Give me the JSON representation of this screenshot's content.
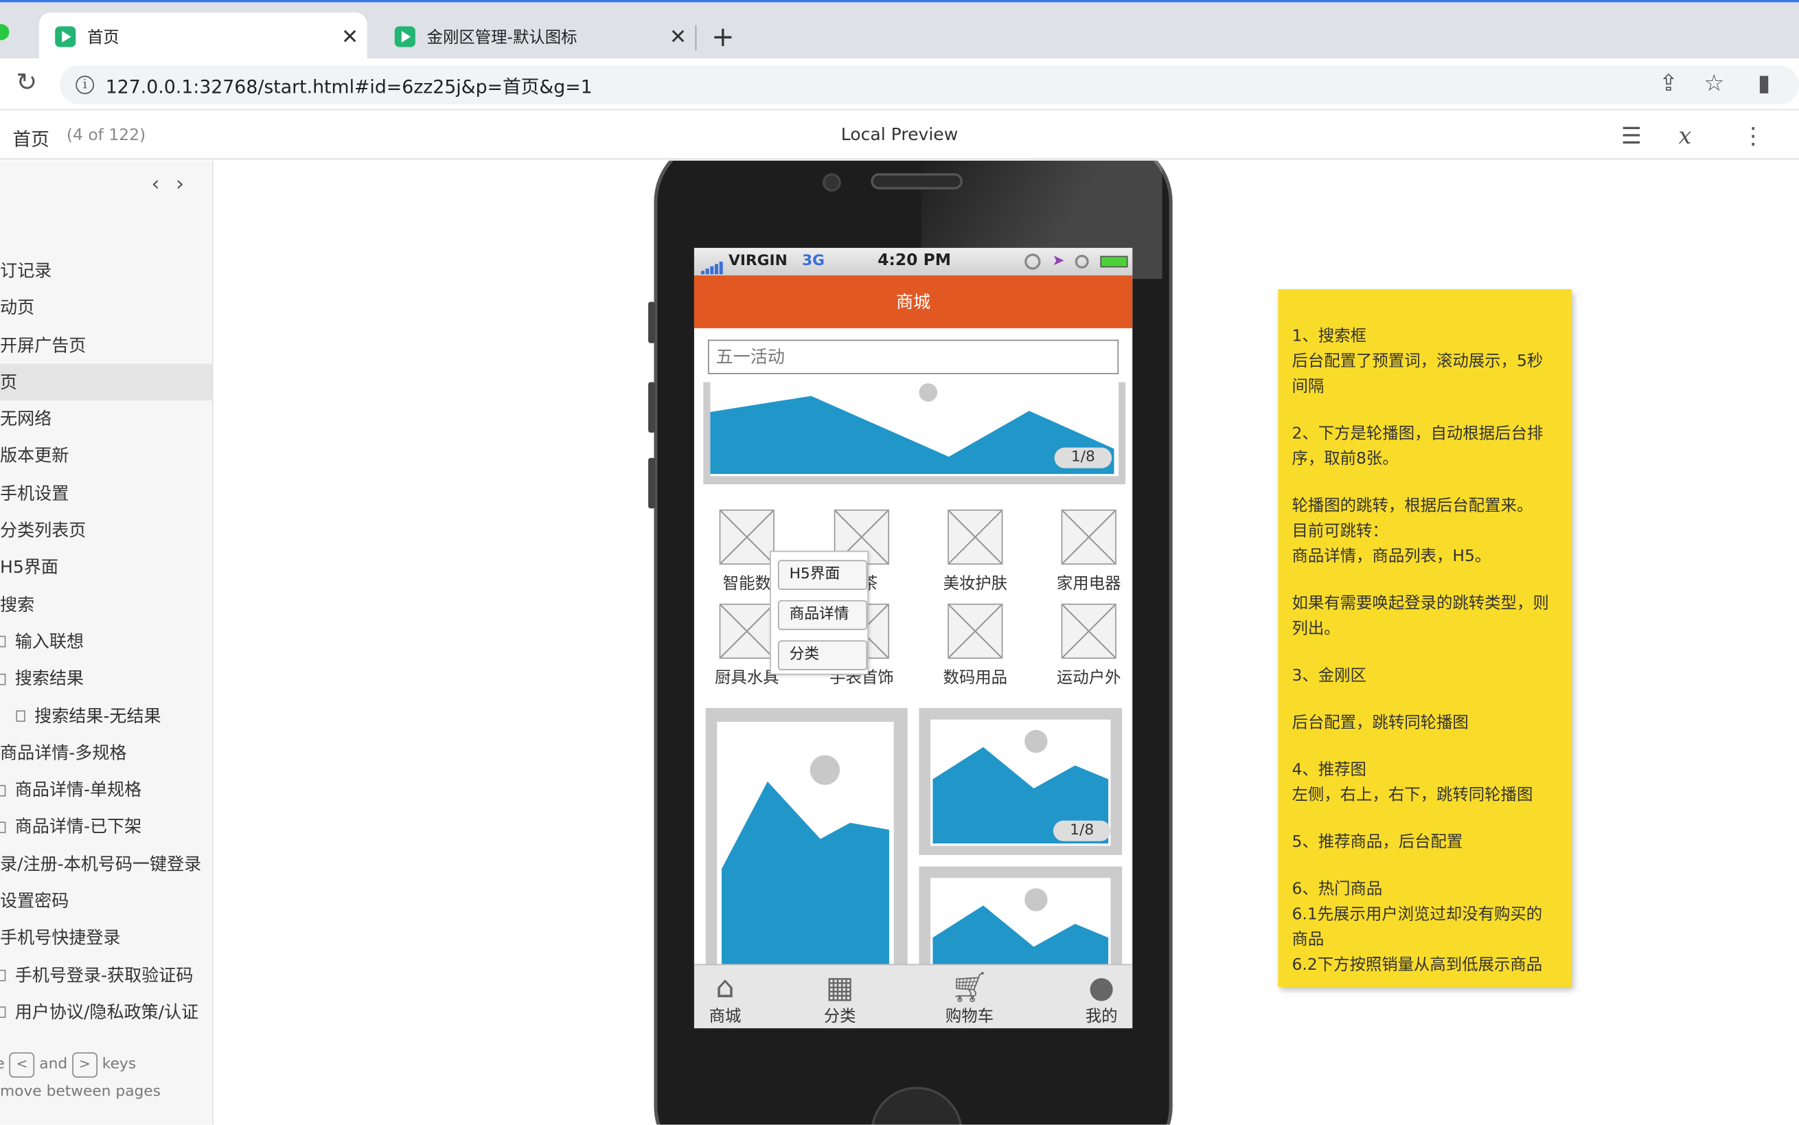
{
  "browser": {
    "tabs": [
      {
        "title": "首页",
        "active": true
      },
      {
        "title": "金刚区管理-默认图标",
        "active": false
      }
    ],
    "new_tab": "+",
    "url": "127.0.0.1:32768/start.html#id=6zz25j&p=首页&g=1"
  },
  "preview": {
    "page_title": "首页",
    "page_count": "(4 of 122)",
    "center_label": "Local Preview"
  },
  "sidebar": {
    "pages": [
      {
        "label": "订记录",
        "icon": false
      },
      {
        "label": "动页",
        "icon": false
      },
      {
        "label": "开屏广告页",
        "icon": false
      },
      {
        "label": "页",
        "icon": false,
        "selected": true
      },
      {
        "label": "无网络",
        "icon": false
      },
      {
        "label": "版本更新",
        "icon": false
      },
      {
        "label": "手机设置",
        "icon": false
      },
      {
        "label": "分类列表页",
        "icon": false
      },
      {
        "label": "H5界面",
        "icon": false
      },
      {
        "label": "搜索",
        "icon": false
      },
      {
        "label": "输入联想",
        "icon": true
      },
      {
        "label": "搜索结果",
        "icon": true
      },
      {
        "label": "搜索结果-无结果",
        "icon": true,
        "indent": true
      },
      {
        "label": "商品详情-多规格",
        "icon": false
      },
      {
        "label": "商品详情-单规格",
        "icon": true
      },
      {
        "label": "商品详情-已下架",
        "icon": true
      },
      {
        "label": "录/注册-本机号码一键登录",
        "icon": false
      },
      {
        "label": "设置密码",
        "icon": false
      },
      {
        "label": "手机号快捷登录",
        "icon": false
      },
      {
        "label": "手机号登录-获取验证码",
        "icon": true
      },
      {
        "label": "用户协议/隐私政策/认证",
        "icon": true
      }
    ],
    "hint": {
      "prefix": "e",
      "key_left": "<",
      "and": "and",
      "key_right": ">",
      "keys": "keys",
      "line2": "move between pages"
    }
  },
  "phone": {
    "status": {
      "carrier": "VIRGIN",
      "network": "3G",
      "time": "4:20 PM"
    },
    "app_title": "商城",
    "search_placeholder": "五一活动",
    "banner_pager": "1/8",
    "categories": [
      "智能数",
      "名茶",
      "美妆护肤",
      "家用电器",
      "厨具水具",
      "手表首饰",
      "数码用品",
      "运动户外"
    ],
    "dropdown": [
      "H5界面",
      "商品详情",
      "分类"
    ],
    "rec_pager": "1/8",
    "tabbar": [
      "商城",
      "分类",
      "购物车",
      "我的"
    ]
  },
  "note": {
    "paragraphs": [
      [
        "1、搜索框",
        "后台配置了预置词，滚动展示，5秒间隔"
      ],
      [
        "2、下方是轮播图，自动根据后台排序，取前8张。"
      ],
      [
        "轮播图的跳转，根据后台配置来。",
        "目前可跳转：",
        "商品详情，商品列表，H5。"
      ],
      [
        "如果有需要唤起登录的跳转类型，则列出。"
      ],
      [
        "3、金刚区"
      ],
      [
        "后台配置，跳转同轮播图"
      ],
      [
        "4、推荐图",
        "左侧，右上，右下，跳转同轮播图"
      ],
      [
        "5、推荐商品，后台配置"
      ],
      [
        "6、热门商品",
        "6.1先展示用户浏览过却没有购买的商品",
        "6.2下方按照销量从高到低展示商品"
      ]
    ]
  },
  "colors": {
    "appbar": "#e25822",
    "banner_blue": "#2196c9",
    "note": "#f9dc2a",
    "tab_fav": "#22b573"
  }
}
